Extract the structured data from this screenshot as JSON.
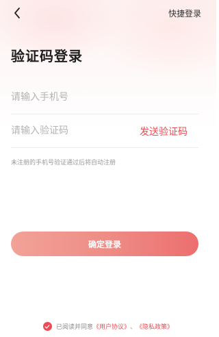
{
  "header": {
    "back_icon": "back-arrow-icon",
    "quick_login_label": "快捷登录"
  },
  "page": {
    "title": "验证码登录"
  },
  "form": {
    "phone_placeholder": "请输入手机号",
    "phone_value": "",
    "code_placeholder": "请输入验证码",
    "code_value": "",
    "send_code_label": "发送验证码",
    "hint": "未注册的手机号验证通过后将自动注册",
    "submit_label": "确定登录"
  },
  "agreement": {
    "checked": true,
    "prefix": "已阅读并同意",
    "user_agreement": "《用户协议》",
    "separator": "、",
    "privacy_policy": "《隐私政策》"
  },
  "colors": {
    "accent": "#ec4c54",
    "button_gradient_start": "#f2a298",
    "button_gradient_end": "#ec6f6f"
  }
}
